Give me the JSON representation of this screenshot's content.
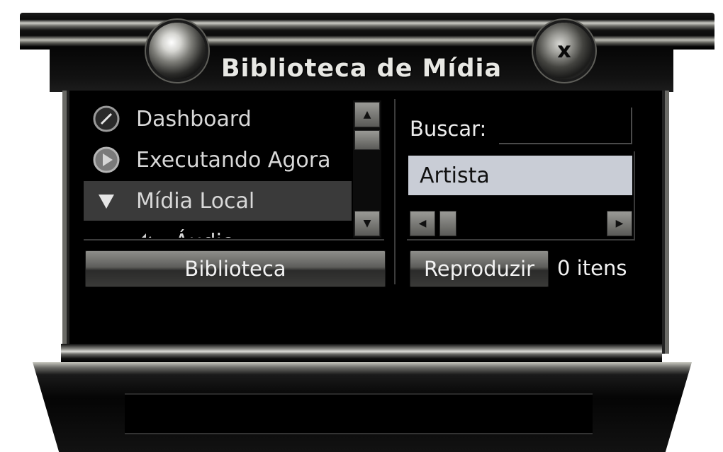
{
  "window": {
    "title": "Biblioteca de Mídia",
    "close_icon": "close-icon"
  },
  "nav": {
    "items": [
      {
        "label": "Dashboard",
        "icon": "dashboard-icon",
        "selected": false
      },
      {
        "label": "Executando Agora",
        "icon": "play-circle-icon",
        "selected": false
      },
      {
        "label": "Mídia Local",
        "icon": "triangle-down-icon",
        "selected": true
      },
      {
        "label": "Áudio",
        "icon": "speaker-icon",
        "selected": false
      }
    ]
  },
  "library_button": "Biblioteca",
  "search": {
    "label": "Buscar:",
    "value": "",
    "placeholder": ""
  },
  "list": {
    "rows": [
      "Artista"
    ]
  },
  "play_button": "Reproduzir",
  "item_count": "0 itens",
  "colors": {
    "selection": "#3a3a3a",
    "list_highlight": "#c9cdd6",
    "text": "#d8d8d8"
  }
}
